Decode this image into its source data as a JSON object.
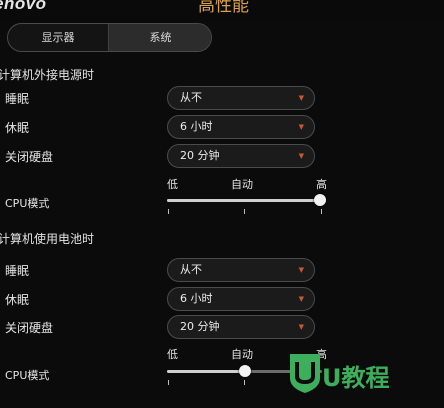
{
  "header": {
    "brand": "enovo",
    "title": "高性能"
  },
  "tabs": [
    {
      "label": "显示器"
    },
    {
      "label": "系统"
    }
  ],
  "ac_section": {
    "title": "计算机外接电源时",
    "rows": [
      {
        "label": "睡眠",
        "value": "从不"
      },
      {
        "label": "休眠",
        "value": "6 小时"
      },
      {
        "label": "关闭硬盘",
        "value": "20 分钟"
      }
    ],
    "cpu": {
      "label": "CPU模式",
      "ticks": [
        "低",
        "自动",
        "高"
      ],
      "level": 1.0
    }
  },
  "battery_section": {
    "title": "计算机使用电池时",
    "rows": [
      {
        "label": "睡眠",
        "value": "从不"
      },
      {
        "label": "休眠",
        "value": "6 小时"
      },
      {
        "label": "关闭硬盘",
        "value": "20 分钟"
      }
    ],
    "cpu": {
      "label": "CPU模式",
      "ticks": [
        "低",
        "自动",
        "高"
      ],
      "level": 0.5
    }
  },
  "dropdown_arrow": "▼",
  "watermark": {
    "text": "U教程"
  },
  "colors": {
    "accent": "#d8a24a",
    "arrow": "#c85a2e",
    "watermark": "#3cae5c"
  }
}
